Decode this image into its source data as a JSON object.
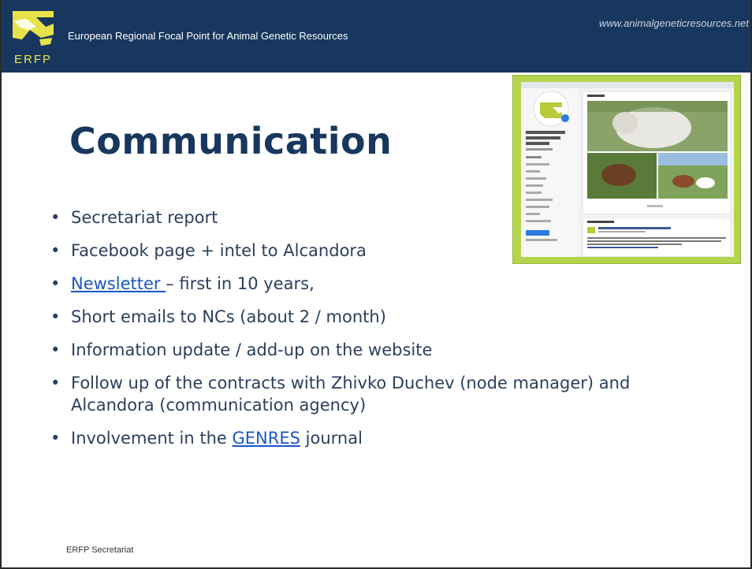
{
  "header": {
    "org_name": "European Regional Focal Point for Animal Genetic Resources",
    "website": "www.animalgeneticresources.net",
    "logo_text": "ERFP"
  },
  "title": "Communication",
  "bullets": {
    "b1": "Secretariat report",
    "b2": "Facebook page + intel to Alcandora",
    "b3_link": "Newsletter ",
    "b3_rest": "– first in 10 years,",
    "b4": "Short emails to NCs (about 2 / month)",
    "b5": "Information update / add-up on the website",
    "b6": "Follow up of the contracts with Zhivko Duchev (node manager) and Alcandora (communication agency)",
    "b7_pre": "Involvement in the ",
    "b7_link": "GENRES",
    "b7_post": " journal"
  },
  "footer": "ERFP Secretariat",
  "colors": {
    "header_bg": "#17375e",
    "title": "#17375e",
    "link": "#1a56c8",
    "frame": "#b3d44d"
  }
}
